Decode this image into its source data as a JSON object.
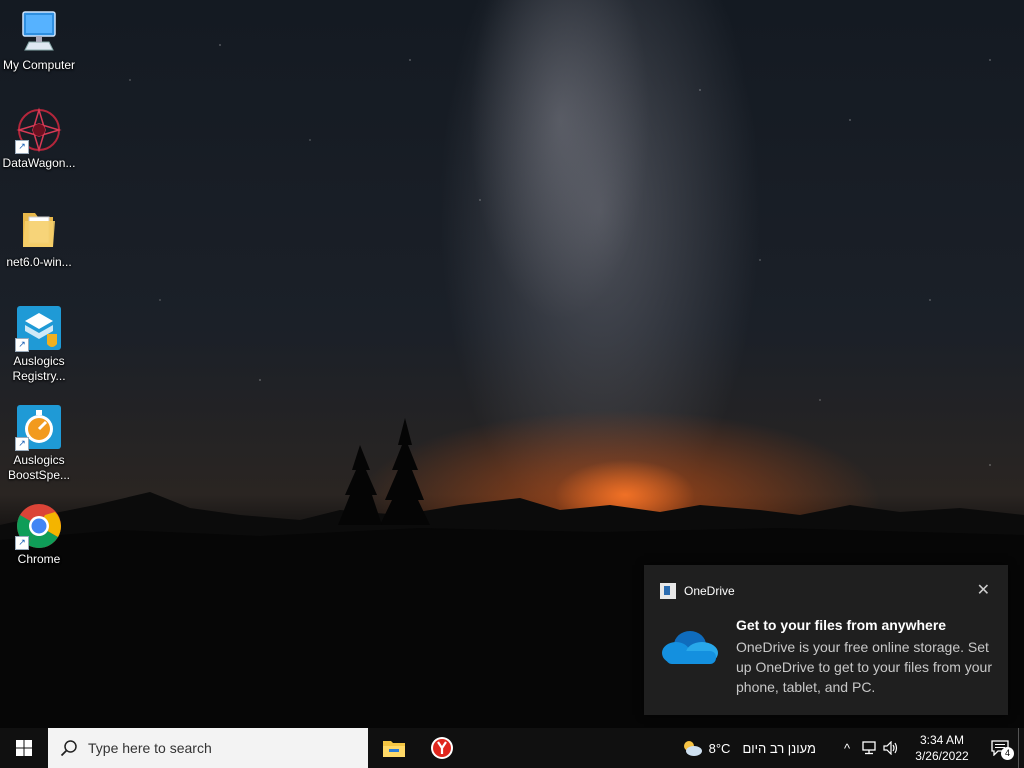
{
  "desktop": {
    "icons": [
      {
        "label": "My Computer",
        "icon": "computer-icon"
      },
      {
        "label": "DataWagon...",
        "icon": "datawagon-icon"
      },
      {
        "label": "net6.0-win...",
        "icon": "folder-icon"
      },
      {
        "label": "Auslogics Registry...",
        "icon": "auslogics-registry-icon"
      },
      {
        "label": "Auslogics BoostSpe...",
        "icon": "auslogics-boostspeed-icon"
      },
      {
        "label": "Chrome",
        "icon": "chrome-icon"
      }
    ]
  },
  "toast": {
    "app_name": "OneDrive",
    "close_glyph": "✕",
    "title": "Get to your files from anywhere",
    "body": "OneDrive is your free online storage. Set up OneDrive to get to your files from your phone, tablet, and PC."
  },
  "taskbar": {
    "search_placeholder": "Type here to search",
    "weather_temp": "8°C",
    "weather_text": "מעונן רב היום",
    "time": "3:34 AM",
    "date": "3/26/2022",
    "notification_count": "4",
    "chevron_glyph": "^"
  },
  "colors": {
    "taskbar": "#101010",
    "toast_bg": "#1f1f1f",
    "search_bg": "#f3f3f3",
    "onedrive_blue": "#0f78d4"
  }
}
